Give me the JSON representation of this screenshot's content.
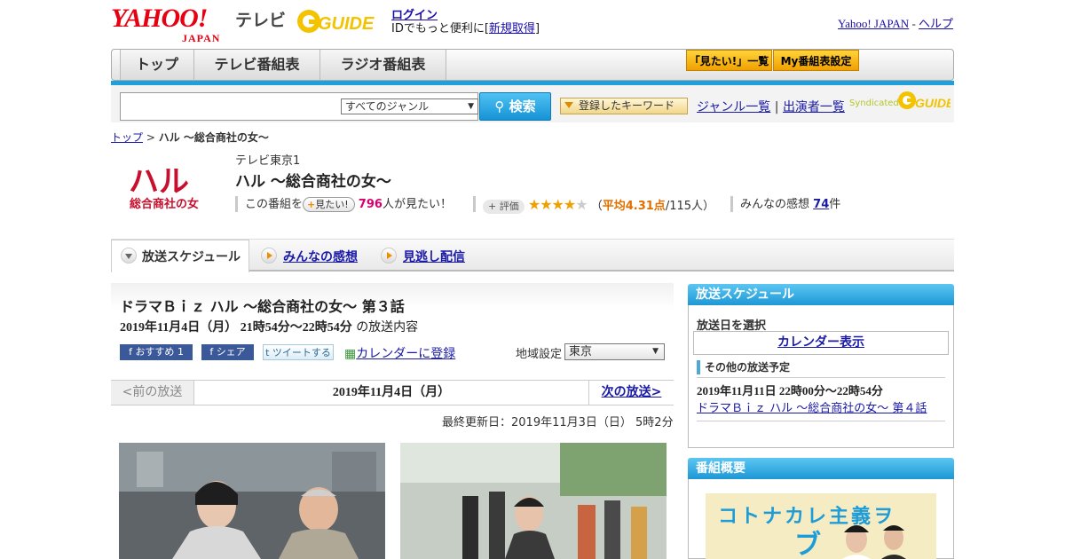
{
  "header": {
    "brand": "YAHOO!",
    "brand_sub": "JAPAN",
    "service": "テレビ",
    "gguide": "GUIDE",
    "login": "ログイン",
    "login_prefix": "IDでもっと便利に[",
    "register": "新規取得",
    "login_suffix": "]",
    "yahoo_japan": "Yahoo! JAPAN",
    "separator": "-",
    "help": "ヘルプ"
  },
  "nav": {
    "tabs": [
      "トップ",
      "テレビ番組表",
      "ラジオ番組表"
    ],
    "mitai_list": "「見たい!」一覧",
    "my_schedule": "My番組表設定"
  },
  "search": {
    "placeholder": "",
    "genre": "すべてのジャンル",
    "button": "検索",
    "keyword_button": "登録したキーワード",
    "genre_list": "ジャンル一覧",
    "pipe": "|",
    "performer_list": "出演者一覧",
    "syndicated": "Syndicated"
  },
  "breadcrumb": {
    "home": "トップ",
    "sep": ">",
    "current": "ハル ～総合商社の女～"
  },
  "program": {
    "logo_text": "ハル",
    "logo_sub": "総合商社の女",
    "station": "テレビ東京1",
    "title": "ハル ～総合商社の女～",
    "want_prefix": "この番組を",
    "want_button": "見たい!",
    "want_count": "796",
    "want_suffix": "人が見たい！",
    "rating_label": "評価",
    "rating_open": "（",
    "rating_avg": "平均4.31点",
    "rating_count": "/115人）",
    "rating_value": 4.31,
    "impressions_label": "みんなの感想",
    "impressions_count": "74",
    "impressions_unit": "件"
  },
  "tabs": [
    "放送スケジュール",
    "みんなの感想",
    "見逃し配信"
  ],
  "episode": {
    "title": "ドラマＢｉｚ ハル ～総合商社の女～ 第３話",
    "date": "2019年11月4日（月） 21時54分～22時54分",
    "date_suffix": "の放送内容",
    "recommend": "おすすめ",
    "recommend_count": "1",
    "share": "シェア",
    "tweet": "ツイートする",
    "calendar": "カレンダーに登録",
    "region_label": "地域設定",
    "region": "東京",
    "prev": "<前の放送",
    "current_date": "2019年11月4日（月）",
    "next": "次の放送>",
    "updated": "最終更新日：2019年11月3日（日） 5時2分"
  },
  "sidebar": {
    "schedule_title": "放送スケジュール",
    "select_day": "放送日を選択",
    "calendar": "カレンダー表示",
    "other_title": "その他の放送予定",
    "other_date": "2019年11月11日 22時00分～22時54分",
    "other_link": "ドラマＢｉｚ ハル ～総合商社の女～ 第４話",
    "overview_title": "番組概要",
    "poster_text": "コトナカレ主義ヲ"
  }
}
